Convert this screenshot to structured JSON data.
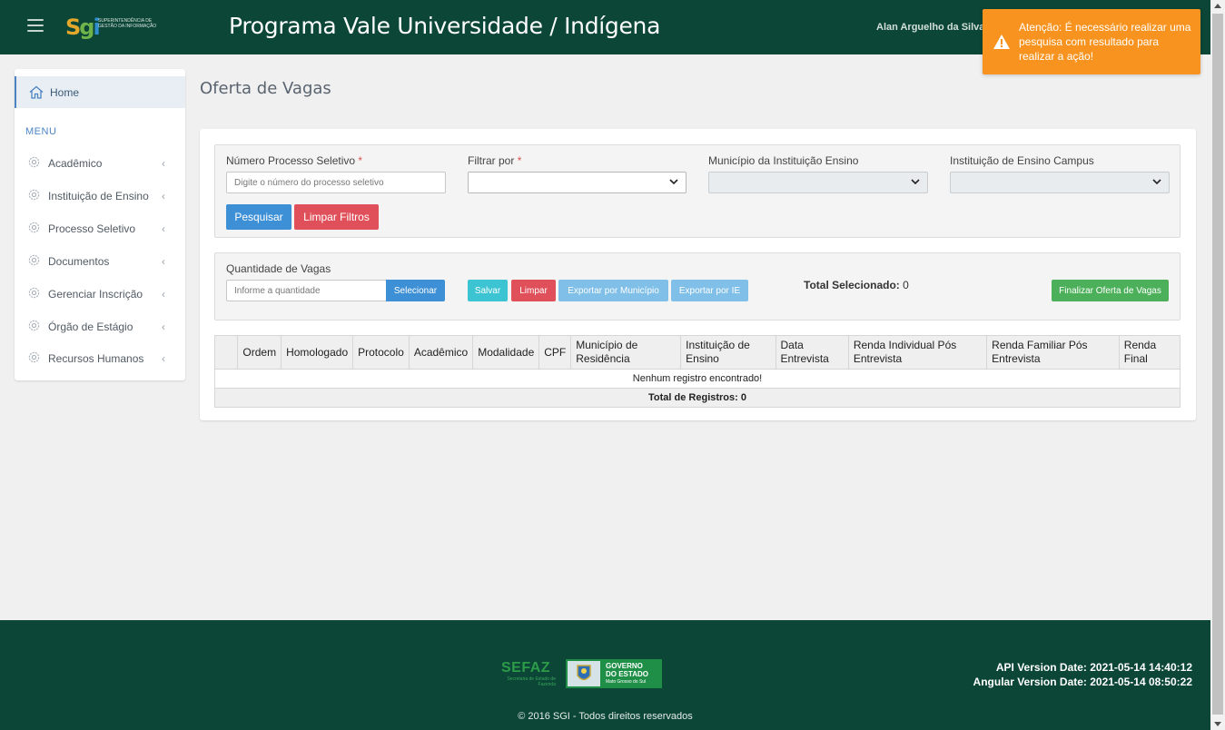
{
  "header": {
    "app_title": "Programa Vale Universidade / Indígena",
    "user_name": "Alan Arguelho da Silva",
    "logo_mark": {
      "s": "S",
      "g": "g",
      "i": "i"
    },
    "logo_text": "SUPERINTENDÊNCIA DE GESTÃO DA INFORMAÇÃO",
    "background_color": "#0b4636"
  },
  "toast": {
    "message": "Atenção: É necessário realizar uma pesquisa com resultado para realizar a ação!",
    "icon": "warning-icon",
    "color": "#f7931e"
  },
  "sidebar": {
    "home_label": "Home",
    "menu_heading": "MENU",
    "items": [
      {
        "label": "Acadêmico"
      },
      {
        "label": "Instituição de Ensino"
      },
      {
        "label": "Processo Seletivo"
      },
      {
        "label": "Documentos"
      },
      {
        "label": "Gerenciar Inscrição"
      },
      {
        "label": "Órgão de Estágio"
      },
      {
        "label": "Recursos Humanos"
      }
    ],
    "item_icon": "gear-icon",
    "chevron": "‹"
  },
  "main": {
    "page_title": "Oferta de Vagas",
    "filters": {
      "processo_label": "Número Processo Seletivo",
      "processo_placeholder": "Digite o número do processo seletivo",
      "filtrar_label": "Filtrar por",
      "municipio_label": "Município da Instituição Ensino",
      "instituicao_label": "Instituição de Ensino Campus",
      "required_mark": "*",
      "search_button": "Pesquisar",
      "clear_button": "Limpar Filtros"
    },
    "actions": {
      "quantidade_label": "Quantidade de Vagas",
      "quantidade_placeholder": "Informe a quantidade",
      "selecionar_button": "Selecionar",
      "salvar_button": "Salvar",
      "limpar_button": "Limpar",
      "export_municipio_button": "Exportar por Município",
      "export_ie_button": "Exportar por IE",
      "total_selected_label": "Total Selecionado:",
      "total_selected_value": "0",
      "finalizar_button": "Finalizar Oferta de Vagas"
    },
    "table": {
      "columns": [
        "",
        "Ordem",
        "Homologado",
        "Protocolo",
        "Acadêmico",
        "Modalidade",
        "CPF",
        "Município de Residência",
        "Instituição de Ensino",
        "Data Entrevista",
        "Renda Individual Pós Entrevista",
        "Renda Familiar Pós Entrevista",
        "Renda Final"
      ],
      "empty_message": "Nenhum registro encontrado!",
      "total_label": "Total de Registros: 0"
    }
  },
  "footer": {
    "sefaz_name": "SEFAZ",
    "sefaz_sub": "Secretaria de Estado de Fazenda",
    "gov_line1": "GOVERNO",
    "gov_line2": "DO ESTADO",
    "gov_line3": "Mato Grosso do Sul",
    "api_version": "API Version Date: 2021-05-14 14:40:12",
    "angular_version": "Angular Version Date: 2021-05-14 08:50:22",
    "copyright": "© 2016 SGI - Todos direitos reservados"
  }
}
